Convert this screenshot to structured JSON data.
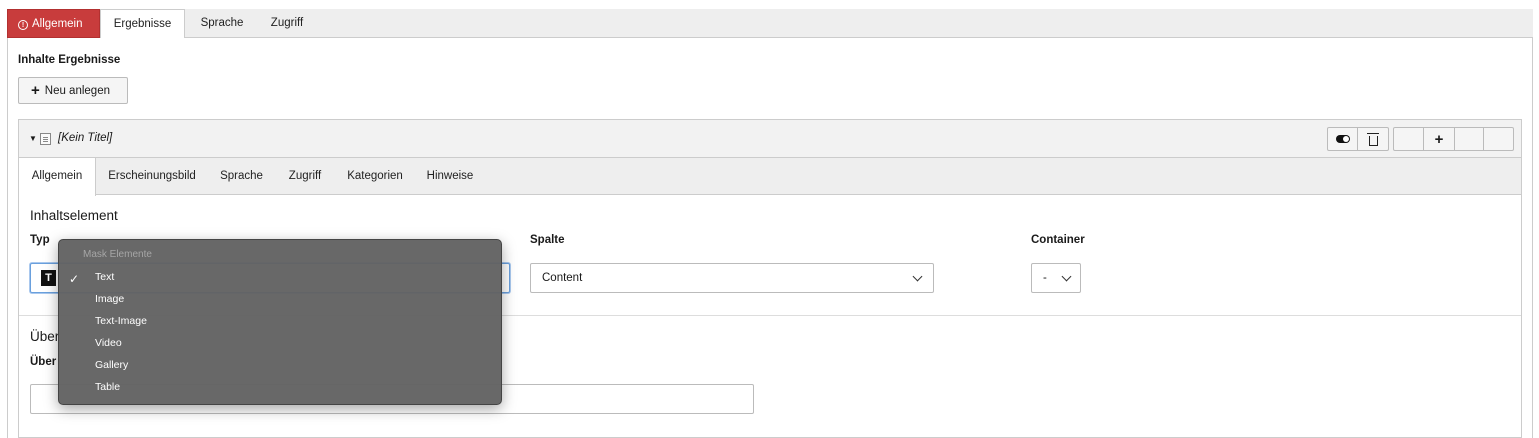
{
  "top_tabs": [
    {
      "label": "Allgemein",
      "state": "error"
    },
    {
      "label": "Ergebnisse",
      "state": "active"
    },
    {
      "label": "Sprache",
      "state": "normal"
    },
    {
      "label": "Zugriff",
      "state": "normal"
    }
  ],
  "section": {
    "title": "Inhalte Ergebnisse",
    "new_button": "Neu anlegen"
  },
  "inline_record": {
    "title": "[Kein Titel]",
    "tabs": [
      "Allgemein",
      "Erscheinungsbild",
      "Sprache",
      "Zugriff",
      "Kategorien",
      "Hinweise"
    ],
    "fieldset_title": "Inhaltselement",
    "fields": {
      "typ_label": "Typ",
      "spalte_label": "Spalte",
      "spalte_value": "Content",
      "container_label": "Container",
      "container_value": "-"
    },
    "fieldset2_title_visible": "Über",
    "field2_label_visible": "Über"
  },
  "dropdown": {
    "group_label": "Mask Elemente",
    "selected": "Text",
    "options": [
      "Text",
      "Image",
      "Text-Image",
      "Video",
      "Gallery",
      "Table"
    ]
  },
  "colors": {
    "error_tab": "#c83c3c",
    "dropdown_bg": "#626262",
    "focus_border": "#6aa0dd"
  }
}
